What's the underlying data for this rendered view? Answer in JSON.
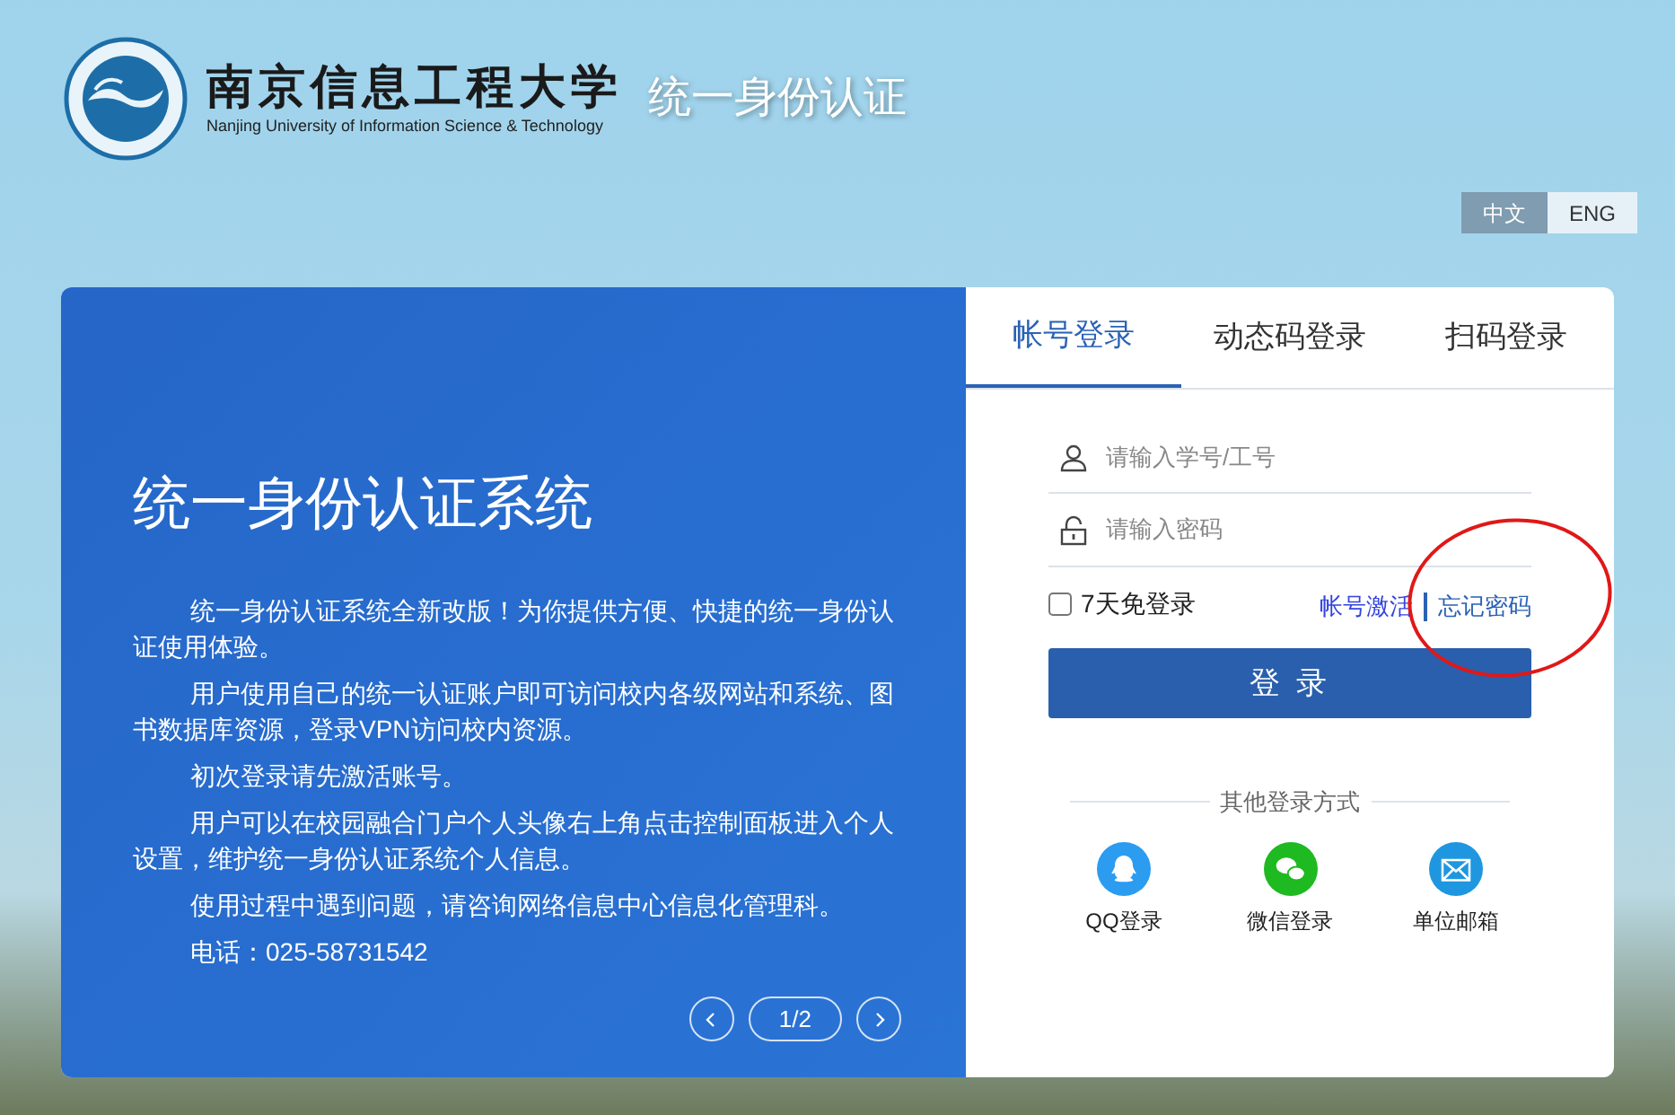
{
  "header": {
    "university_name": "南京信息工程大学",
    "university_name_en": "Nanjing University of Information Science & Technology",
    "system_title": "统一身份认证"
  },
  "language_switch": [
    {
      "label": "中文",
      "selected": true
    },
    {
      "label": "ENG",
      "selected": false
    }
  ],
  "intro": {
    "title": "统一身份认证系统",
    "paragraphs": [
      "统一身份认证系统全新改版！为你提供方便、快捷的统一身份认证使用体验。",
      "用户使用自己的统一认证账户即可访问校内各级网站和系统、图书数据库资源，登录VPN访问校内资源。",
      "初次登录请先激活账号。",
      "用户可以在校园融合门户个人头像右上角点击控制面板进入个人设置，维护统一身份认证系统个人信息。",
      "使用过程中遇到问题，请咨询网络信息中心信息化管理科。",
      "电话：025-58731542"
    ],
    "pager": "1/2"
  },
  "login_tabs": [
    {
      "label": "帐号登录",
      "selected": true
    },
    {
      "label": "动态码登录",
      "selected": false
    },
    {
      "label": "扫码登录",
      "selected": false
    }
  ],
  "username_field": {
    "placeholder": "请输入学号/工号"
  },
  "password_field": {
    "placeholder": "请输入密码"
  },
  "remember": {
    "label": "7天免登录",
    "checked": false
  },
  "links": [
    "帐号激活",
    "忘记密码"
  ],
  "login_button": "登 录",
  "other_methods": {
    "title": "其他登录方式",
    "items": [
      {
        "kind": "qq",
        "label": "QQ登录",
        "color": "#2b9cf0"
      },
      {
        "kind": "wechat",
        "label": "微信登录",
        "color": "#1fb922"
      },
      {
        "kind": "mail",
        "label": "单位邮箱",
        "color": "#1f97e0"
      }
    ]
  }
}
